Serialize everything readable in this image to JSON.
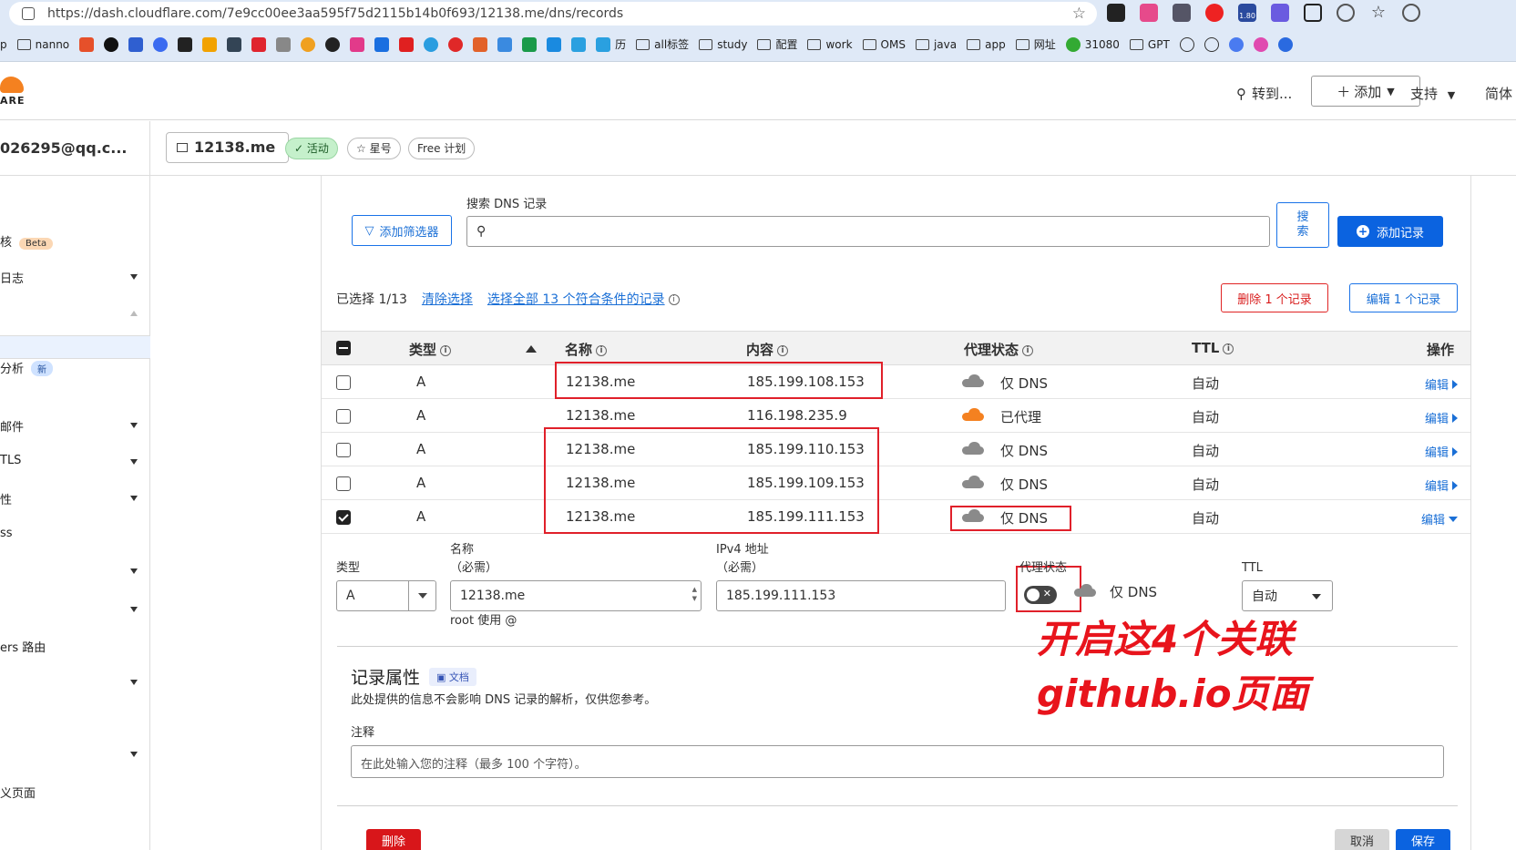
{
  "browser": {
    "url": "https://dash.cloudflare.com/7e9cc00ee3aa595f75d2115b14b0f693/12138.me/dns/records",
    "bookmarks": [
      "p",
      "nanno",
      "all标签",
      "study",
      "配置",
      "work",
      "OMS",
      "java",
      "app",
      "网址",
      "31080",
      "GPT",
      "历"
    ],
    "ext_badge": "1.80"
  },
  "header": {
    "logo_text": "ARE",
    "goto": "转到...",
    "add": "添加",
    "support": "支持",
    "lang": "简体"
  },
  "sidebar": {
    "account": "026295@qq.c...",
    "items": [
      {
        "label": "核",
        "badge": "Beta"
      },
      {
        "label": "日志"
      },
      {
        "label": "分析",
        "badge": "新"
      },
      {
        "label": "邮件"
      },
      {
        "label": "TLS"
      },
      {
        "label": "性"
      },
      {
        "label": "ss"
      },
      {
        "label": "ers 路由"
      },
      {
        "label": "义页面"
      }
    ]
  },
  "zone": {
    "name": "12138.me",
    "status": "活动",
    "star": "星号",
    "plan": "Free 计划"
  },
  "toolbar": {
    "filter": "添加筛选器",
    "search_label": "搜索 DNS 记录",
    "search_btn": "搜索",
    "add_record": "添加记录"
  },
  "selection": {
    "info": "已选择 1/13",
    "clear": "清除选择",
    "select_all": "选择全部 13 个符合条件的记录",
    "delete": "删除 1 个记录",
    "edit": "编辑 1 个记录"
  },
  "table": {
    "headers": {
      "type": "类型",
      "name": "名称",
      "content": "内容",
      "proxy": "代理状态",
      "ttl": "TTL",
      "actions": "操作"
    },
    "edit_label": "编辑",
    "rows": [
      {
        "type": "A",
        "name": "12138.me",
        "content": "185.199.108.153",
        "proxy": "仅 DNS",
        "ttl": "自动"
      },
      {
        "type": "A",
        "name": "12138.me",
        "content": "116.198.235.9",
        "proxy": "已代理",
        "ttl": "自动"
      },
      {
        "type": "A",
        "name": "12138.me",
        "content": "185.199.110.153",
        "proxy": "仅 DNS",
        "ttl": "自动"
      },
      {
        "type": "A",
        "name": "12138.me",
        "content": "185.199.109.153",
        "proxy": "仅 DNS",
        "ttl": "自动"
      },
      {
        "type": "A",
        "name": "12138.me",
        "content": "185.199.111.153",
        "proxy": "仅 DNS",
        "ttl": "自动"
      }
    ]
  },
  "form": {
    "type_label": "类型",
    "type_value": "A",
    "name_label": "名称",
    "name_required": "（必需）",
    "name_value": "12138.me",
    "name_hint": "root 使用 @",
    "ip_label": "IPv4 地址",
    "ip_required": "（必需）",
    "ip_value": "185.199.111.153",
    "proxy_label": "代理状态",
    "proxy_value": "仅 DNS",
    "ttl_label": "TTL",
    "ttl_value": "自动"
  },
  "attrs": {
    "title": "记录属性",
    "doc": "文档",
    "desc": "此处提供的信息不会影响 DNS 记录的解析，仅供您参考。",
    "note_label": "注释",
    "note_placeholder": "在此处输入您的注释（最多 100 个字符）。"
  },
  "footer": {
    "delete": "删除",
    "cancel": "取消",
    "save": "保存"
  },
  "annotation": {
    "line1": "开启这4个关联",
    "line2": "github.io页面"
  }
}
